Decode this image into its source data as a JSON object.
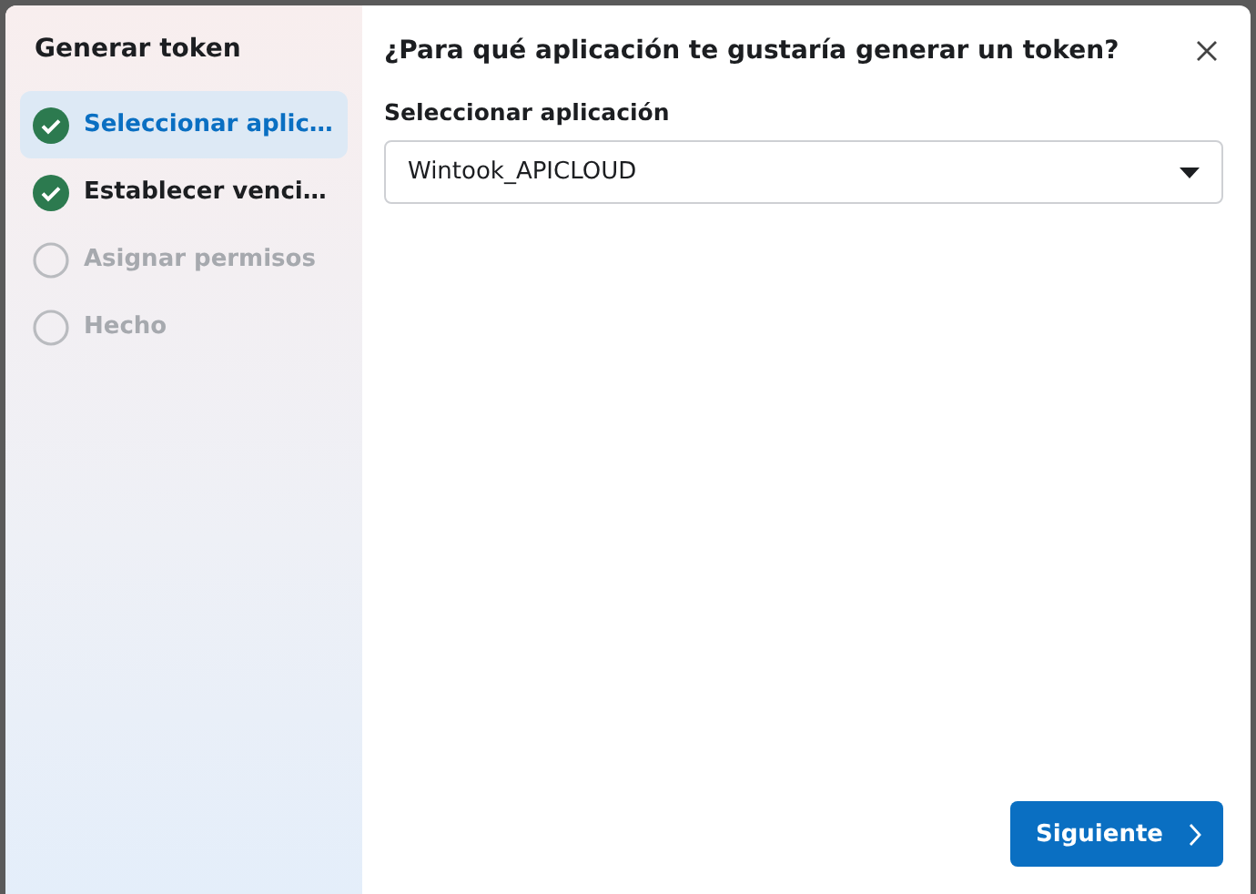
{
  "sidebar": {
    "title": "Generar token",
    "steps": [
      {
        "label": "Seleccionar aplic…",
        "completed": true,
        "selected": true
      },
      {
        "label": "Establecer venci…",
        "completed": true,
        "selected": false
      },
      {
        "label": "Asignar permisos",
        "completed": false,
        "selected": false
      },
      {
        "label": "Hecho",
        "completed": false,
        "selected": false
      }
    ]
  },
  "main": {
    "title": "¿Para qué aplicación te gustaría generar un token?",
    "field": {
      "label": "Seleccionar aplicación",
      "value": "Wintook_APICLOUD"
    },
    "next_button": "Siguiente"
  }
}
